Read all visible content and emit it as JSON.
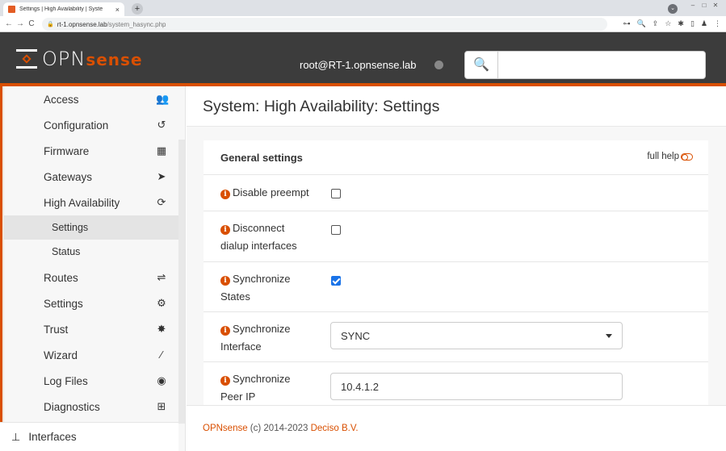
{
  "browser": {
    "tab_title": "Settings | High Availability | Syste",
    "tab_close": "×",
    "new_tab": "+",
    "url_host": "rt-1.opnsense.lab",
    "url_path": "/system_hasync.php",
    "back": "←",
    "forward": "→",
    "reload": "C",
    "lock": "🔒",
    "profile_initial": "⌄",
    "window_controls": [
      "–",
      "□",
      "✕"
    ],
    "toolbar_icons": [
      "⊶",
      "🔍",
      "⇪",
      "☆",
      "✱",
      "▯",
      "♟",
      "⋮"
    ]
  },
  "header": {
    "logo_opn": "OPN",
    "logo_sense": "sense",
    "user": "root@RT-1.opnsense.lab",
    "search_icon": "🔍",
    "search_placeholder": ""
  },
  "sidebar": {
    "items": [
      {
        "label": "Access",
        "icon": "users-icon",
        "glyph": "👥"
      },
      {
        "label": "Configuration",
        "icon": "history-icon",
        "glyph": "↺"
      },
      {
        "label": "Firmware",
        "icon": "building-icon",
        "glyph": "▦"
      },
      {
        "label": "Gateways",
        "icon": "location-arrow-icon",
        "glyph": "➤"
      },
      {
        "label": "High Availability",
        "icon": "refresh-icon",
        "glyph": "⟳"
      }
    ],
    "subitems": [
      {
        "label": "Settings",
        "active": true
      },
      {
        "label": "Status",
        "active": false
      }
    ],
    "items2": [
      {
        "label": "Routes",
        "icon": "signpost-icon",
        "glyph": "⇌"
      },
      {
        "label": "Settings",
        "icon": "cogs-icon",
        "glyph": "⚙"
      },
      {
        "label": "Trust",
        "icon": "certificate-icon",
        "glyph": "✸"
      },
      {
        "label": "Wizard",
        "icon": "magic-icon",
        "glyph": "⁄"
      },
      {
        "label": "Log Files",
        "icon": "eye-icon",
        "glyph": "◉"
      },
      {
        "label": "Diagnostics",
        "icon": "medkit-icon",
        "glyph": "⊞"
      }
    ],
    "footer_label": "Interfaces",
    "footer_icon": "sitemap-icon",
    "footer_glyph": "⊥"
  },
  "page": {
    "title": "System: High Availability: Settings"
  },
  "panel": {
    "header": "General settings",
    "full_help": "full help",
    "info_glyph": "i",
    "rows": [
      {
        "label": "Disable preempt",
        "type": "checkbox",
        "checked": false
      },
      {
        "label": "Disconnect dialup interfaces",
        "type": "checkbox",
        "checked": false
      },
      {
        "label": "Synchronize States",
        "type": "checkbox",
        "checked": true
      },
      {
        "label": "Synchronize Interface",
        "type": "select",
        "value": "SYNC"
      },
      {
        "label": "Synchronize Peer IP",
        "type": "text",
        "value": "10.4.1.2"
      }
    ]
  },
  "footer": {
    "brand": "OPNsense",
    "copyright": " (c) 2014-2023 ",
    "company": "Deciso B.V."
  },
  "colors": {
    "accent": "#d94f00",
    "header_bg": "#3c3c3c",
    "checkbox_checked": "#1a73e8"
  }
}
